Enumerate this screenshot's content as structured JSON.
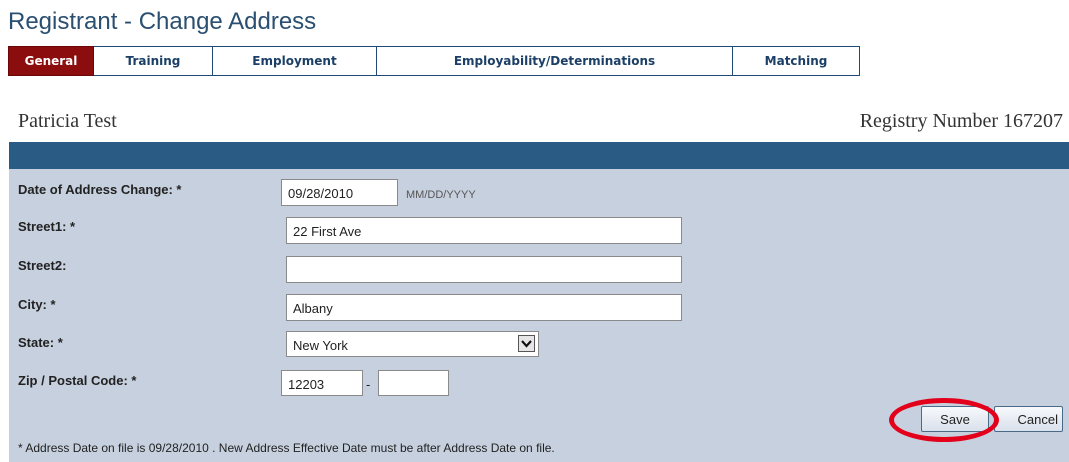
{
  "page_title": "Registrant - Change Address",
  "tabs": [
    {
      "label": "General",
      "active": true
    },
    {
      "label": "Training",
      "active": false
    },
    {
      "label": "Employment",
      "active": false
    },
    {
      "label": "Employability/Determinations",
      "active": false
    },
    {
      "label": "Matching",
      "active": false
    }
  ],
  "registrant_name": "Patricia Test",
  "registry_number": "Registry Number 167207",
  "form": {
    "date_label": "Date of Address Change: *",
    "date_value": "09/28/2010",
    "date_hint": "MM/DD/YYYY",
    "street1_label": "Street1: *",
    "street1_value": "22 First Ave",
    "street2_label": "Street2:",
    "street2_value": "",
    "city_label": "City: *",
    "city_value": "Albany",
    "state_label": "State: *",
    "state_value": "New York",
    "zip_label": "Zip / Postal Code: *",
    "zip_value": "12203",
    "zip_separator": "-",
    "zip_ext_value": ""
  },
  "buttons": {
    "save": "Save",
    "cancel": "Cancel"
  },
  "footnote": "* Address Date on file is 09/28/2010 . New Address Effective Date must be after Address Date on file.",
  "colors": {
    "title": "#2a4f70",
    "active_tab": "#8b0d0d",
    "band": "#2a5b85",
    "panel": "#c7d0de",
    "highlight_ring": "#e3001b"
  },
  "icons": {
    "state_dropdown": "chevron-down-icon"
  }
}
